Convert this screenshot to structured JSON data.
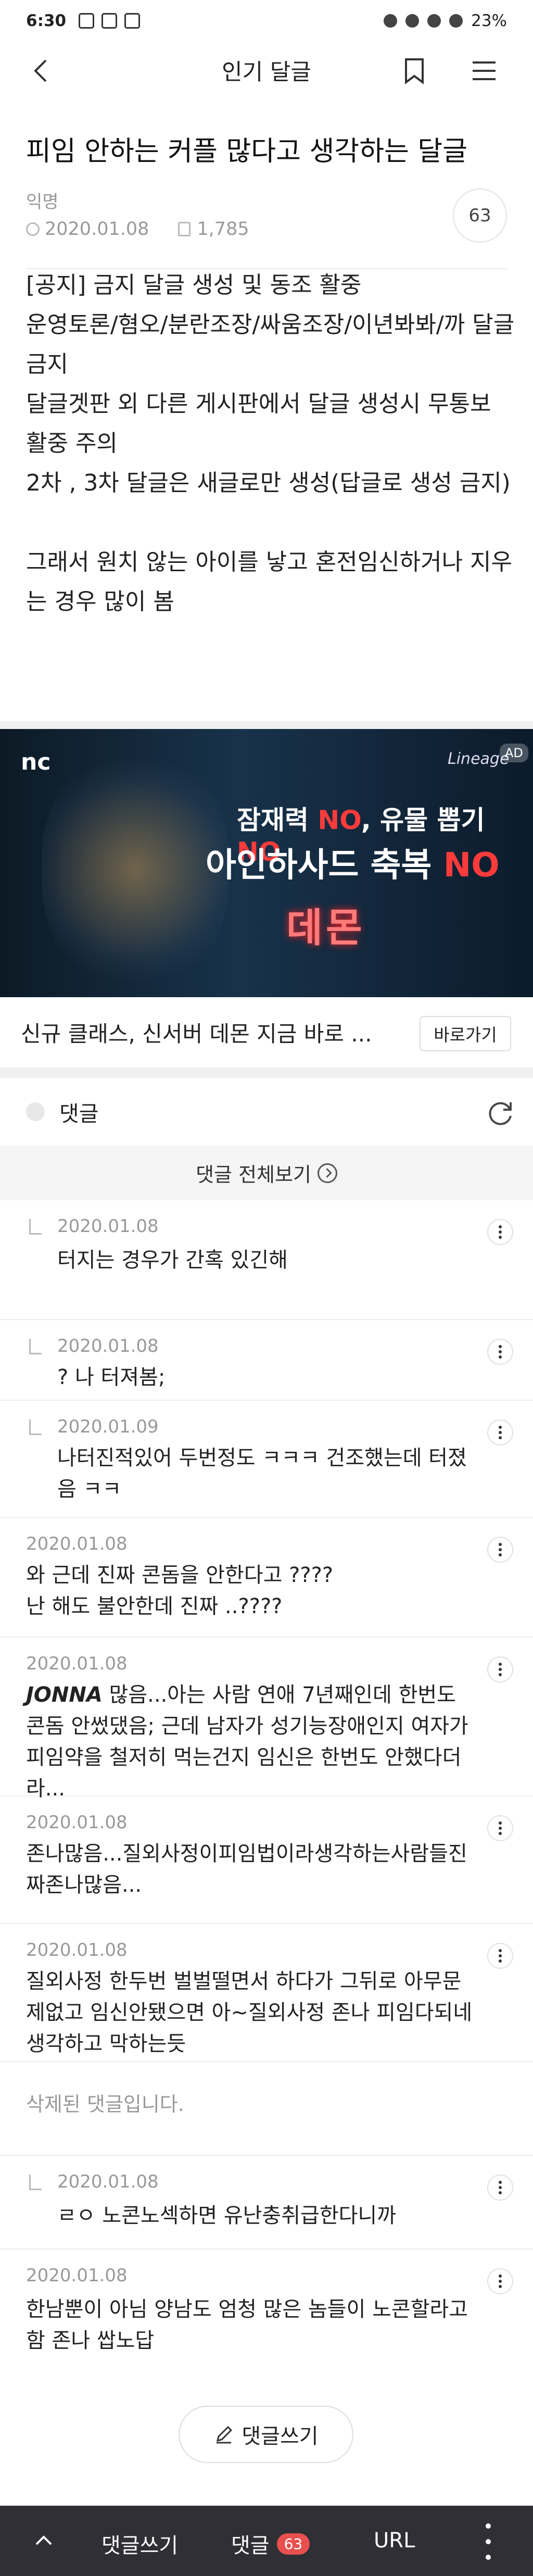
{
  "status_bar": {
    "time": "6:30",
    "battery": "23%"
  },
  "app_bar": {
    "title": "인기 달글"
  },
  "post": {
    "title": "피임 안하는 커플 많다고 생각하는 달글",
    "author": "익명",
    "date": "2020.01.08",
    "views": "1,785",
    "comment_count": "63",
    "body_notice": "[공지] 금지 달글 생성 및 동조 활중\n운영토론/혐오/분란조장/싸움조장/이년봐봐/까 달글 금지\n달글겟판 외 다른 게시판에서 달글 생성시 무통보 활중 주의\n2차 , 3차 달글은 새글로만 생성(답글로 생성 금지)",
    "body_text": "그래서 원치 않는 아이를 낳고 혼전임신하거나 지우는 경우 많이 봄"
  },
  "ad": {
    "logo": "nc",
    "brand": "Lineage",
    "tag": "AD",
    "headline_1a": "잠재력 ",
    "headline_1b": "NO",
    "headline_1c": ", 유물 뽑기 ",
    "headline_1d": "NO",
    "headline_2a": "아인하사드 축복 ",
    "headline_2b": "NO",
    "demon_logo": "데몬",
    "caption": "신규 클래스, 신서버 데몬 지금 바로 ...",
    "button": "바로가기"
  },
  "comments_section": {
    "header": "댓글",
    "view_all": "댓글 전체보기",
    "deleted_text": "삭제된 댓글입니다.",
    "items": [
      {
        "date": "2020.01.08",
        "text": "터지는 경우가 간혹 있긴해"
      },
      {
        "date": "2020.01.08",
        "text": "? 나 터져봄;"
      },
      {
        "date": "2020.01.09",
        "text": "나터진적있어 두번정도 ㅋㅋㅋ 건조했는데 터졌음 ㅋㅋ"
      },
      {
        "date": "2020.01.08",
        "text": "와 근데 진짜 콘돔을 안한다고 ????\n난 해도 불안한데 진짜 ..????"
      },
      {
        "date": "2020.01.08",
        "bold": "JONNA",
        "text": " 많음...아는 사람 연애 7년째인데 한번도 콘돔 안썼댔음; 근데 남자가 성기능장애인지 여자가 피임약을 철저히 먹는건지 임신은 한번도 안했다더라..."
      },
      {
        "date": "2020.01.08",
        "text": "존나많음...질외사정이피임법이라생각하는사람들진짜존나많음..."
      },
      {
        "date": "2020.01.08",
        "text": "질외사정 한두번 벌벌떨면서 하다가 그뒤로 아무문제없고 임신안됐으면 아~질외사정 존나 피임다되네 생각하고 막하는듯"
      },
      {
        "date": "2020.01.08",
        "text": "ㄹㅇ 노콘노섹하면 유난충취급한다니까"
      },
      {
        "date": "2020.01.08",
        "text": "한남뿐이 아님 양남도 엄청 많은 놈들이 노콘할라고 함 존나 쌉노답"
      }
    ]
  },
  "write_button": {
    "label": "댓글쓰기"
  },
  "bottom_bar": {
    "write": "댓글쓰기",
    "comments": "댓글",
    "comments_badge": "63",
    "url": "URL"
  }
}
